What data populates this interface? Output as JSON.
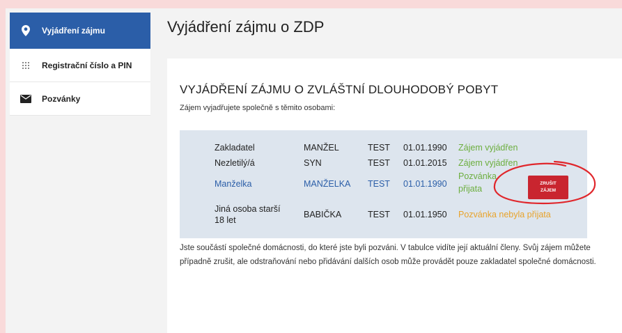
{
  "sidebar": {
    "items": [
      {
        "label": "Vyjádření zájmu",
        "icon": "location-pin-icon"
      },
      {
        "label": "Registrační číslo a PIN",
        "icon": "grid-icon"
      },
      {
        "label": "Pozvánky",
        "icon": "envelope-icon"
      }
    ]
  },
  "header": {
    "title": "Vyjádření zájmu o ZDP"
  },
  "main": {
    "title": "VYJÁDŘENÍ ZÁJMU O ZVLÁŠTNÍ DLOUHODOBÝ POBYT",
    "subtitle": "Zájem vyjadřujete společně s těmito osobami:",
    "members": [
      {
        "role": "Zakladatel",
        "name": "MANŽEL",
        "surname": "TEST",
        "dob": "01.01.1990",
        "status": "Zájem vyjádřen"
      },
      {
        "role": "Nezletilý/á",
        "name": "SYN",
        "surname": "TEST",
        "dob": "01.01.2015",
        "status": "Zájem vyjádřen"
      },
      {
        "role": "Manželka",
        "name": "MANŽELKA",
        "surname": "TEST",
        "dob": "01.01.1990",
        "status_line1": "Pozvánka",
        "status_line2": "přijata"
      },
      {
        "role_line1": "Jiná osoba starší",
        "role_line2": "18 let",
        "name": "BABIČKA",
        "surname": "TEST",
        "dob": "01.01.1950",
        "status": "Pozvánka nebyla přijata"
      }
    ],
    "cancel_button": {
      "line1": "ZRUŠIT",
      "line2": "ZÁJEM"
    },
    "note": "Jste součástí společné domácnosti, do které jste byli pozváni. V tabulce vidíte její aktuální členy. Svůj zájem můžete případně zrušit, ale odstraňování nebo přidávání dalších osob může provádět pouze zakladatel společné domácnosti."
  },
  "colors": {
    "accent": "#2b5ea8",
    "status_ok": "#6cae3e",
    "status_pending": "#e8a32b",
    "danger": "#c9252f",
    "annotation": "#e0262b"
  }
}
